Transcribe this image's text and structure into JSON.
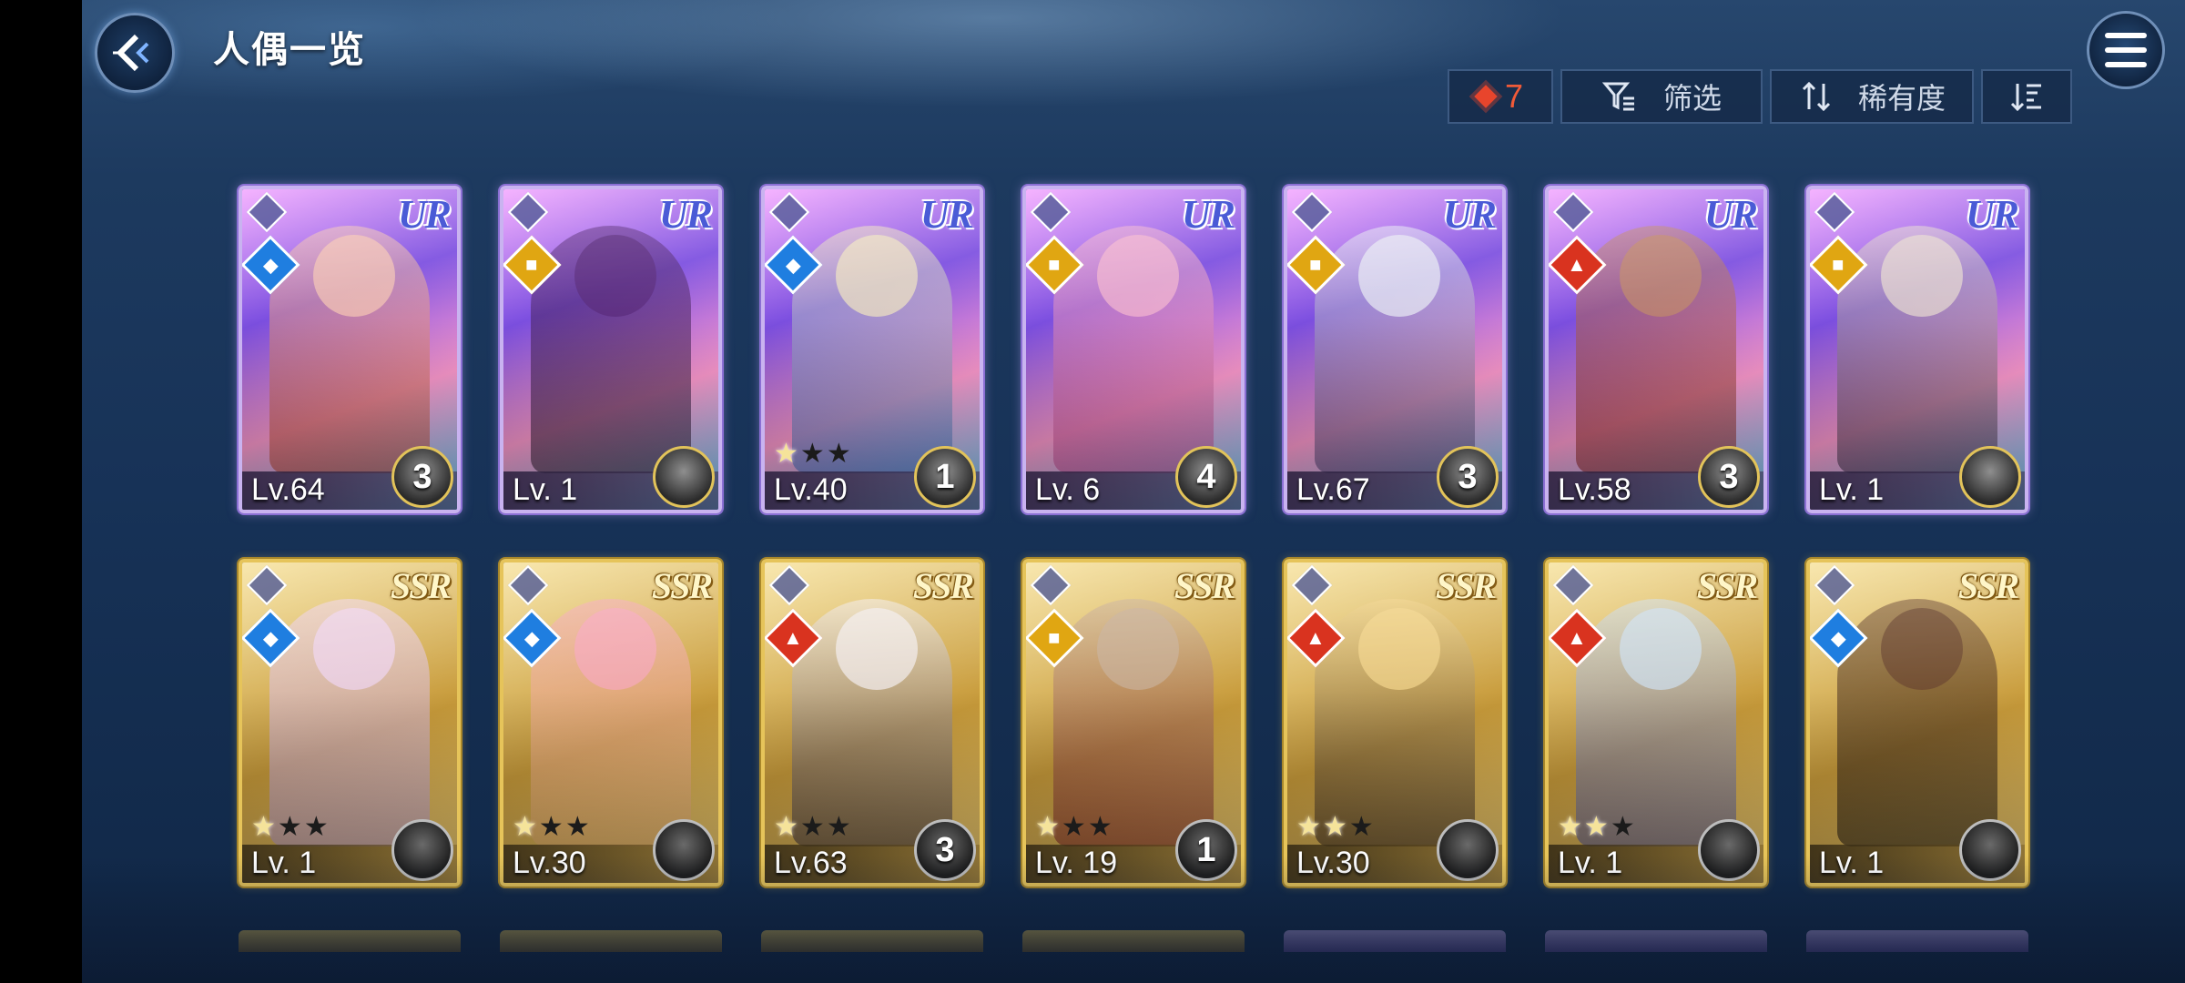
{
  "header": {
    "title": "人偶一览"
  },
  "toolbar": {
    "count_value": "7",
    "filter_label": "筛选",
    "sort_label": "稀有度"
  },
  "colors": {
    "accent_count": "#f05a38",
    "ur_frame": "#c9b3f0",
    "ssr_frame": "#e6c45a"
  },
  "cards": [
    {
      "rarity": "UR",
      "level": "Lv.64",
      "badge": "3",
      "element": "water-icon",
      "stars": null,
      "palette": [
        "#f6c8b4",
        "#b8422d"
      ]
    },
    {
      "rarity": "UR",
      "level": "Lv. 1",
      "badge": "",
      "element": "light-icon",
      "stars": null,
      "palette": [
        "#5a2b7a",
        "#2a1a2c"
      ]
    },
    {
      "rarity": "UR",
      "level": "Lv.40",
      "badge": "1",
      "element": "water-icon",
      "stars": 1,
      "palette": [
        "#f1e5c0",
        "#3c6cc0"
      ]
    },
    {
      "rarity": "UR",
      "level": "Lv. 6",
      "badge": "4",
      "element": "light-icon",
      "stars": null,
      "palette": [
        "#f5b8cf",
        "#c04890"
      ]
    },
    {
      "rarity": "UR",
      "level": "Lv.67",
      "badge": "3",
      "element": "light-icon",
      "stars": null,
      "palette": [
        "#e9ecf4",
        "#4b3d6e"
      ]
    },
    {
      "rarity": "UR",
      "level": "Lv.58",
      "badge": "3",
      "element": "fire-icon",
      "stars": null,
      "palette": [
        "#c28a6a",
        "#8a1f1f"
      ]
    },
    {
      "rarity": "UR",
      "level": "Lv. 1",
      "badge": "",
      "element": "light-icon",
      "stars": null,
      "palette": [
        "#e8dcd0",
        "#3b2a45"
      ]
    },
    {
      "rarity": "SSR",
      "level": "Lv. 1",
      "badge": "",
      "element": "water-icon",
      "stars": 1,
      "palette": [
        "#f0d5f2",
        "#b89ad8"
      ]
    },
    {
      "rarity": "SSR",
      "level": "Lv.30",
      "badge": "",
      "element": "water-icon",
      "stars": 1,
      "palette": [
        "#f6a8bf",
        "#e7b070"
      ]
    },
    {
      "rarity": "SSR",
      "level": "Lv.63",
      "badge": "3",
      "element": "fire-icon",
      "stars": 1,
      "palette": [
        "#f4eef0",
        "#33293a"
      ]
    },
    {
      "rarity": "SSR",
      "level": "Lv. 19",
      "badge": "1",
      "element": "light-icon",
      "stars": 1,
      "palette": [
        "#c9b09a",
        "#7a1e22"
      ]
    },
    {
      "rarity": "SSR",
      "level": "Lv.30",
      "badge": "",
      "element": "fire-icon",
      "stars": 2,
      "palette": [
        "#f3d58d",
        "#2a1c1a"
      ]
    },
    {
      "rarity": "SSR",
      "level": "Lv. 1",
      "badge": "",
      "element": "fire-icon",
      "stars": 2,
      "palette": [
        "#cfe0ef",
        "#4b4f9a"
      ]
    },
    {
      "rarity": "SSR",
      "level": "Lv. 1",
      "badge": "",
      "element": "water-icon",
      "stars": null,
      "palette": [
        "#6b4630",
        "#1a1410"
      ]
    }
  ]
}
